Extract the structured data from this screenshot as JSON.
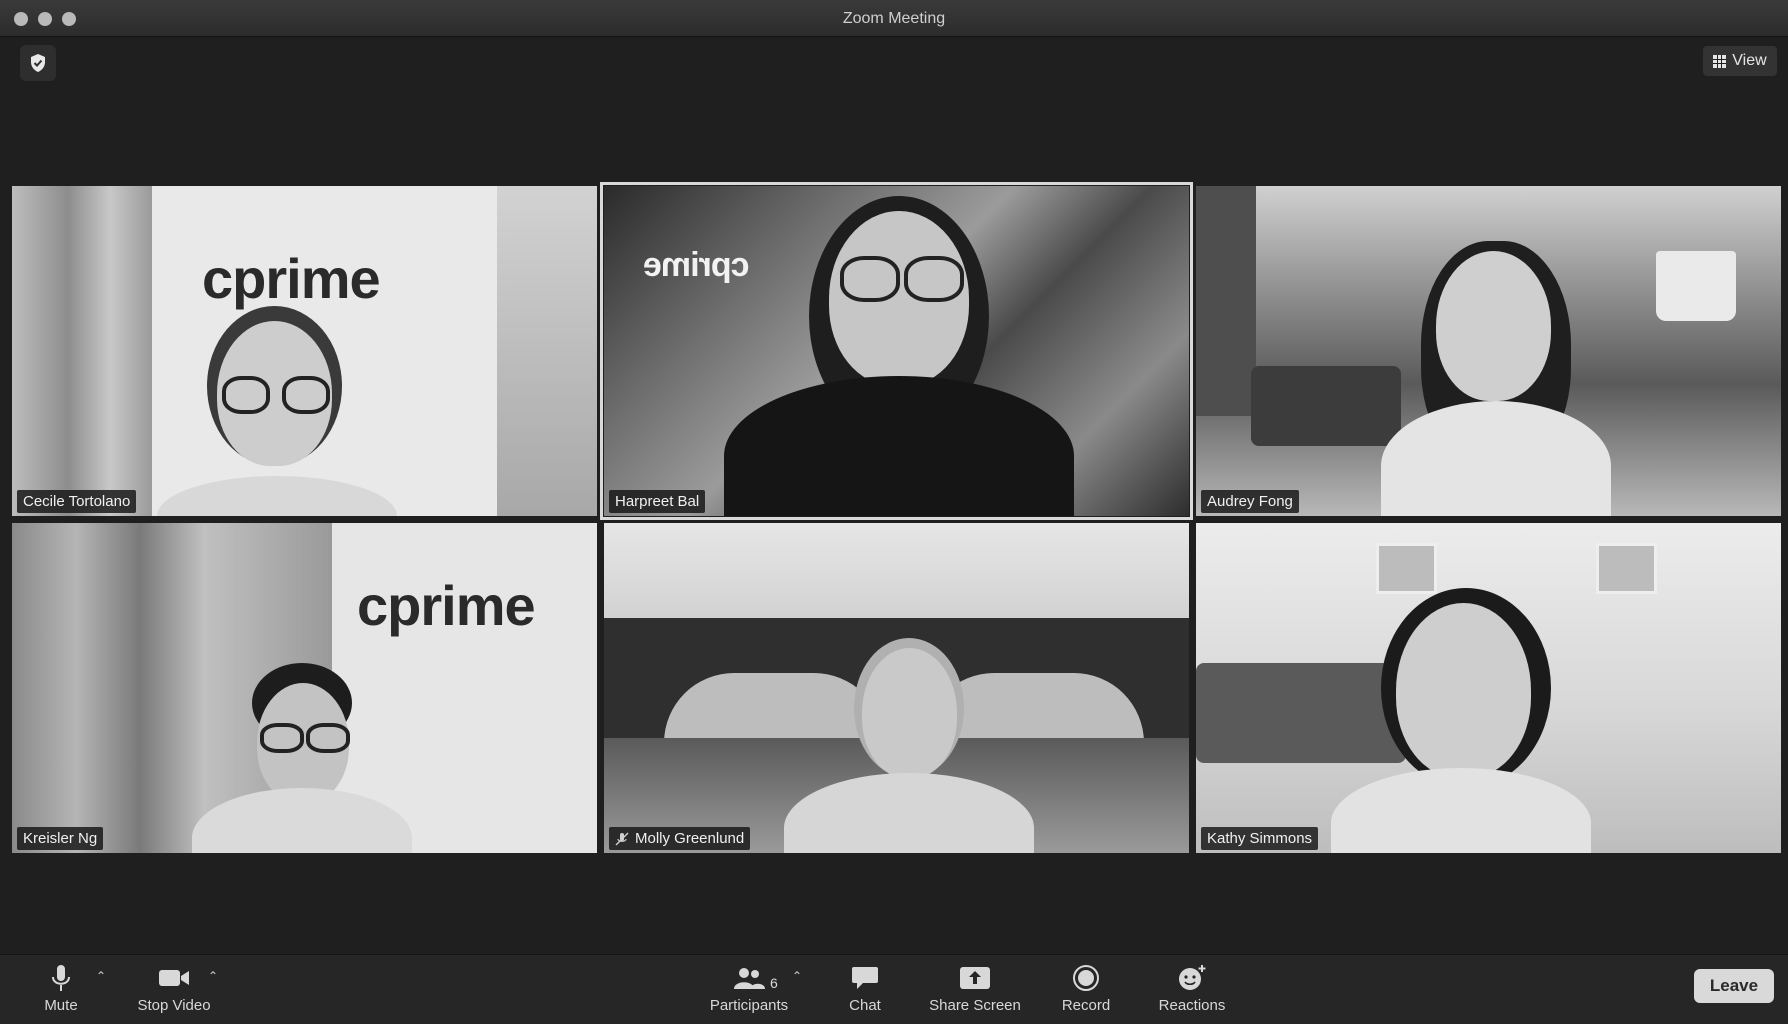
{
  "window": {
    "title": "Zoom Meeting"
  },
  "header": {
    "view_label": "View"
  },
  "participants": [
    {
      "name": "Cecile Tortolano",
      "background_logo": "cprime",
      "muted": false
    },
    {
      "name": "Harpreet Bal",
      "background_logo": "cprime",
      "muted": false,
      "active_speaker": true
    },
    {
      "name": "Audrey Fong",
      "muted": false
    },
    {
      "name": "Kreisler Ng",
      "background_logo": "cprime",
      "muted": false
    },
    {
      "name": "Molly Greenlund",
      "muted": true
    },
    {
      "name": "Kathy Simmons",
      "muted": false
    }
  ],
  "toolbar": {
    "mute_label": "Mute",
    "stop_video_label": "Stop Video",
    "participants_label": "Participants",
    "participants_count": "6",
    "chat_label": "Chat",
    "share_screen_label": "Share Screen",
    "record_label": "Record",
    "reactions_label": "Reactions",
    "leave_label": "Leave"
  },
  "colors": {
    "window_bg": "#1f1f1f",
    "toolbar_bg": "#262626",
    "tile_label_bg": "#141414",
    "active_outline": "#d9d9d9"
  }
}
